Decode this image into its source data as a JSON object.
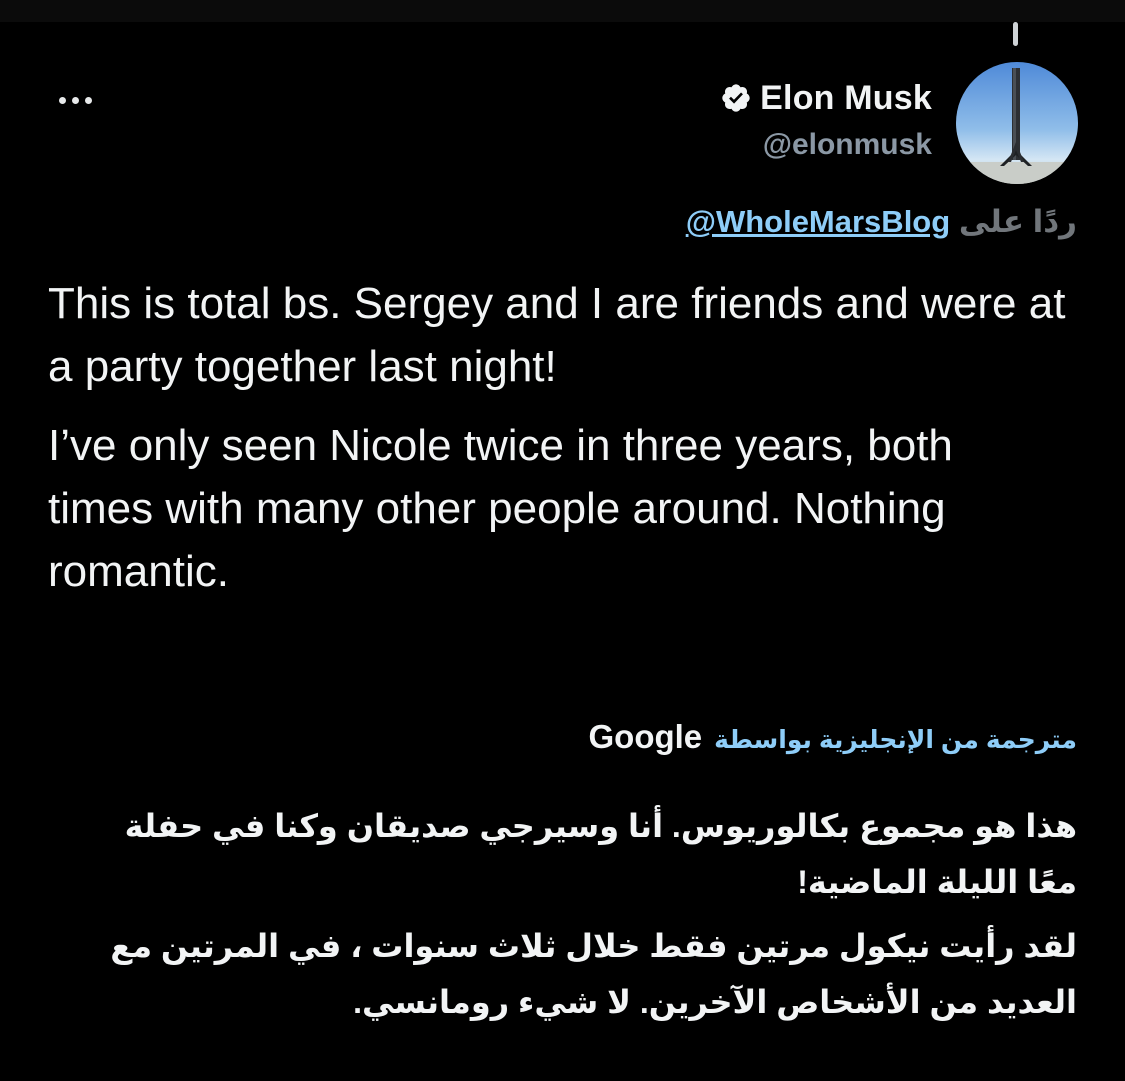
{
  "tweet": {
    "author": {
      "display_name": "Elon Musk",
      "handle": "@elonmusk",
      "verified": true,
      "avatar_icon": "rocket-booster-avatar"
    },
    "more_icon": "more-dots-icon",
    "reply": {
      "prefix": "ردًا على",
      "mention": "@WholeMarsBlog"
    },
    "text": {
      "paragraph_1": "This is total bs. Sergey and I are friends and were at a party together last night!",
      "paragraph_2": "I’ve only seen Nicole twice in three years, both times with many other people around. Nothing romantic."
    },
    "translation": {
      "label": "مترجمة من الإنجليزية بواسطة",
      "provider": "Google",
      "paragraph_1": "هذا هو مجموع بكالوريوس. أنا وسيرجي صديقان وكنا في حفلة معًا الليلة الماضية!",
      "paragraph_2": "لقد رأيت نيكول مرتين فقط خلال ثلاث سنوات ، في المرتين مع العديد من الأشخاص الآخرين. لا شيء رومانسي."
    }
  },
  "colors": {
    "background": "#000000",
    "text_primary": "#f2f4f5",
    "text_secondary": "#71767b",
    "link": "#8ecdf8"
  }
}
